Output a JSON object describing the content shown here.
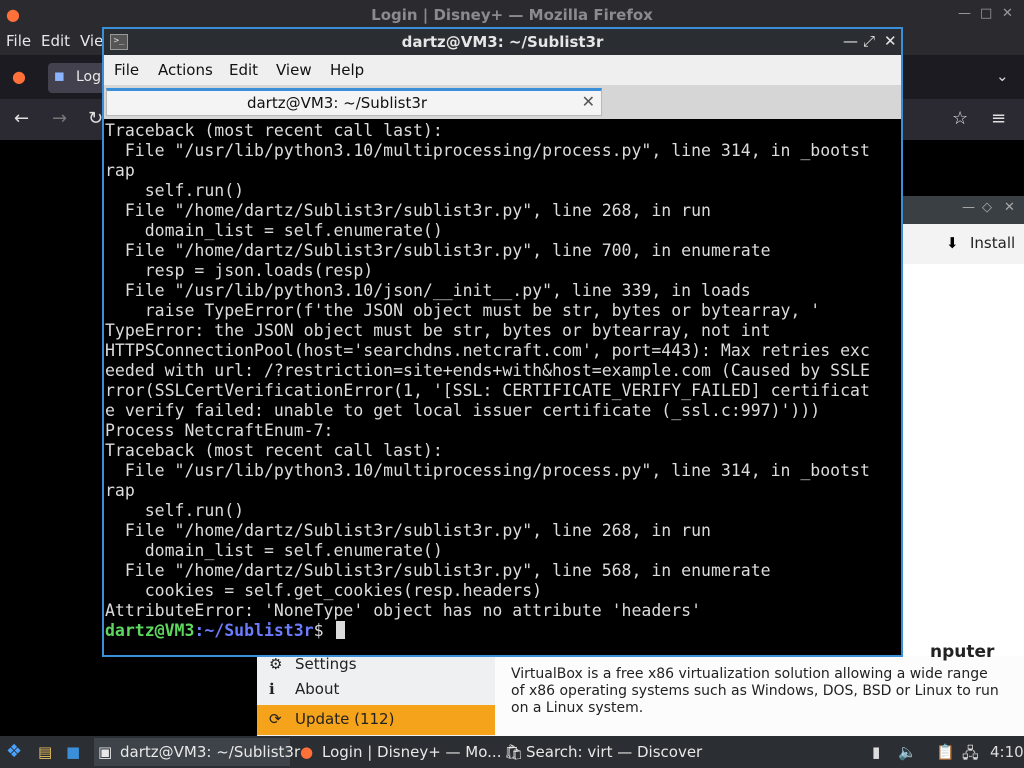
{
  "firefox": {
    "window_title": "Login | Disney+ — Mozilla Firefox",
    "menu": [
      "File",
      "Edit",
      "Vie"
    ],
    "tab_label": "Log"
  },
  "discover": {
    "install_label": "Install",
    "sidebar": [
      "Settings",
      "About",
      "Update (112)"
    ],
    "heading_fragment": "nputer",
    "description": "VirtualBox is a free x86 virtualization solution allowing a wide range of x86 operating systems such as Windows, DOS, BSD or Linux to run on a Linux system."
  },
  "terminal": {
    "window_title": "dartz@VM3: ~/Sublist3r",
    "menu": [
      "File",
      "Actions",
      "Edit",
      "View",
      "Help"
    ],
    "tab_title": "dartz@VM3: ~/Sublist3r",
    "lines": [
      "Traceback (most recent call last):",
      "  File \"/usr/lib/python3.10/multiprocessing/process.py\", line 314, in _bootst",
      "rap",
      "    self.run()",
      "  File \"/home/dartz/Sublist3r/sublist3r.py\", line 268, in run",
      "    domain_list = self.enumerate()",
      "  File \"/home/dartz/Sublist3r/sublist3r.py\", line 700, in enumerate",
      "    resp = json.loads(resp)",
      "  File \"/usr/lib/python3.10/json/__init__.py\", line 339, in loads",
      "    raise TypeError(f'the JSON object must be str, bytes or bytearray, '",
      "TypeError: the JSON object must be str, bytes or bytearray, not int",
      "HTTPSConnectionPool(host='searchdns.netcraft.com', port=443): Max retries exc",
      "eeded with url: /?restriction=site+ends+with&host=example.com (Caused by SSLE",
      "rror(SSLCertVerificationError(1, '[SSL: CERTIFICATE_VERIFY_FAILED] certificat",
      "e verify failed: unable to get local issuer certificate (_ssl.c:997)')))",
      "Process NetcraftEnum-7:",
      "Traceback (most recent call last):",
      "  File \"/usr/lib/python3.10/multiprocessing/process.py\", line 314, in _bootst",
      "rap",
      "    self.run()",
      "  File \"/home/dartz/Sublist3r/sublist3r.py\", line 268, in run",
      "    domain_list = self.enumerate()",
      "  File \"/home/dartz/Sublist3r/sublist3r.py\", line 568, in enumerate",
      "    cookies = self.get_cookies(resp.headers)",
      "AttributeError: 'NoneType' object has no attribute 'headers'"
    ],
    "prompt_user": "dartz@VM3",
    "prompt_path": ":~/Sublist3r",
    "prompt_symbol": "$ "
  },
  "taskbar": {
    "items": [
      "dartz@VM3: ~/Sublist3r",
      "Login | Disney+ — Mo...",
      "Search: virt — Discover"
    ],
    "clock": "4:10"
  }
}
